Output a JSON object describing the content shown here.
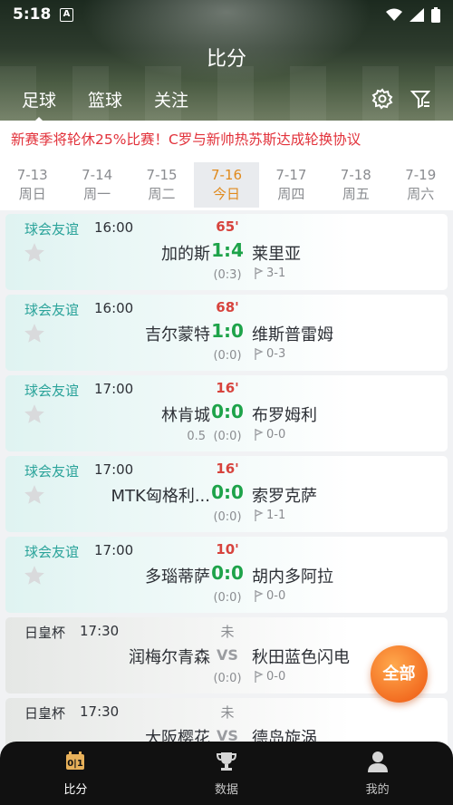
{
  "status": {
    "time": "5:18",
    "notif": "A"
  },
  "title": "比分",
  "tabs": [
    {
      "label": "足球",
      "active": true
    },
    {
      "label": "篮球",
      "active": false
    },
    {
      "label": "关注",
      "active": false
    }
  ],
  "ticker": "新赛季将轮休25%比赛！C罗与新帅热苏斯达成轮换协议",
  "dates": [
    {
      "date": "7-13",
      "day": "周日"
    },
    {
      "date": "7-14",
      "day": "周一"
    },
    {
      "date": "7-15",
      "day": "周二"
    },
    {
      "date": "7-16",
      "day": "今日"
    },
    {
      "date": "7-17",
      "day": "周四"
    },
    {
      "date": "7-18",
      "day": "周五"
    },
    {
      "date": "7-19",
      "day": "周六"
    }
  ],
  "matches": [
    {
      "league": "球会友谊",
      "time": "16:00",
      "minute": "65'",
      "home": "加的斯",
      "score": "1:4",
      "away": "莱里亚",
      "hcp": "",
      "ht": "(0:3)",
      "corner": "3-1"
    },
    {
      "league": "球会友谊",
      "time": "16:00",
      "minute": "68'",
      "home": "吉尔蒙特",
      "score": "1:0",
      "away": "维斯普雷姆",
      "hcp": "",
      "ht": "(0:0)",
      "corner": "0-3"
    },
    {
      "league": "球会友谊",
      "time": "17:00",
      "minute": "16'",
      "home": "林肯城",
      "score": "0:0",
      "away": "布罗姆利",
      "hcp": "0.5",
      "ht": "(0:0)",
      "corner": "0-0"
    },
    {
      "league": "球会友谊",
      "time": "17:00",
      "minute": "16'",
      "home": "MTK匈格利...",
      "score": "0:0",
      "away": "索罗克萨",
      "hcp": "",
      "ht": "(0:0)",
      "corner": "1-1"
    },
    {
      "league": "球会友谊",
      "time": "17:00",
      "minute": "10'",
      "home": "多瑙蒂萨",
      "score": "0:0",
      "away": "胡内多阿拉",
      "hcp": "",
      "ht": "(0:0)",
      "corner": "0-0"
    },
    {
      "league": "日皇杯",
      "time": "17:30",
      "minute": "未",
      "home": "润梅尔青森",
      "score": "VS",
      "away": "秋田蓝色闪电",
      "hcp": "",
      "ht": "(0:0)",
      "corner": "0-0"
    },
    {
      "league": "日皇杯",
      "time": "17:30",
      "minute": "未",
      "home": "大阪樱花",
      "score": "VS",
      "away": "德岛旋涡",
      "hcp": "",
      "ht": "",
      "corner": ""
    }
  ],
  "fab": "全部",
  "nav": [
    {
      "label": "比分",
      "icon": "scoreboard-icon",
      "active": true
    },
    {
      "label": "数据",
      "icon": "trophy-icon",
      "active": false
    },
    {
      "label": "我的",
      "icon": "user-icon",
      "active": false
    }
  ]
}
